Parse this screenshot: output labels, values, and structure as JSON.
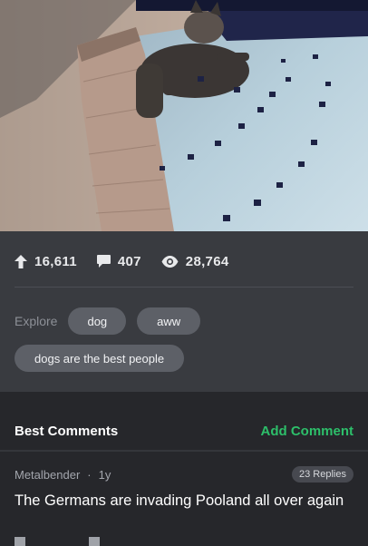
{
  "stats": {
    "upvotes": "16,611",
    "comments": "407",
    "views": "28,764"
  },
  "explore": {
    "label": "Explore",
    "tags": [
      "dog",
      "aww",
      "dogs are the best people"
    ]
  },
  "comments_section": {
    "title": "Best Comments",
    "add_label": "Add Comment"
  },
  "comment": {
    "author": "Metalbender",
    "separator": "·",
    "age": "1y",
    "replies": "23 Replies",
    "text": "The Germans are invading Pooland all over again"
  },
  "colors": {
    "accent_green": "#2dbf6a",
    "panel": "#393b40",
    "background": "#26272b",
    "tag": "#5d6067"
  },
  "icons": [
    "arrow-up-icon",
    "comment-bubble-icon",
    "eye-icon"
  ]
}
